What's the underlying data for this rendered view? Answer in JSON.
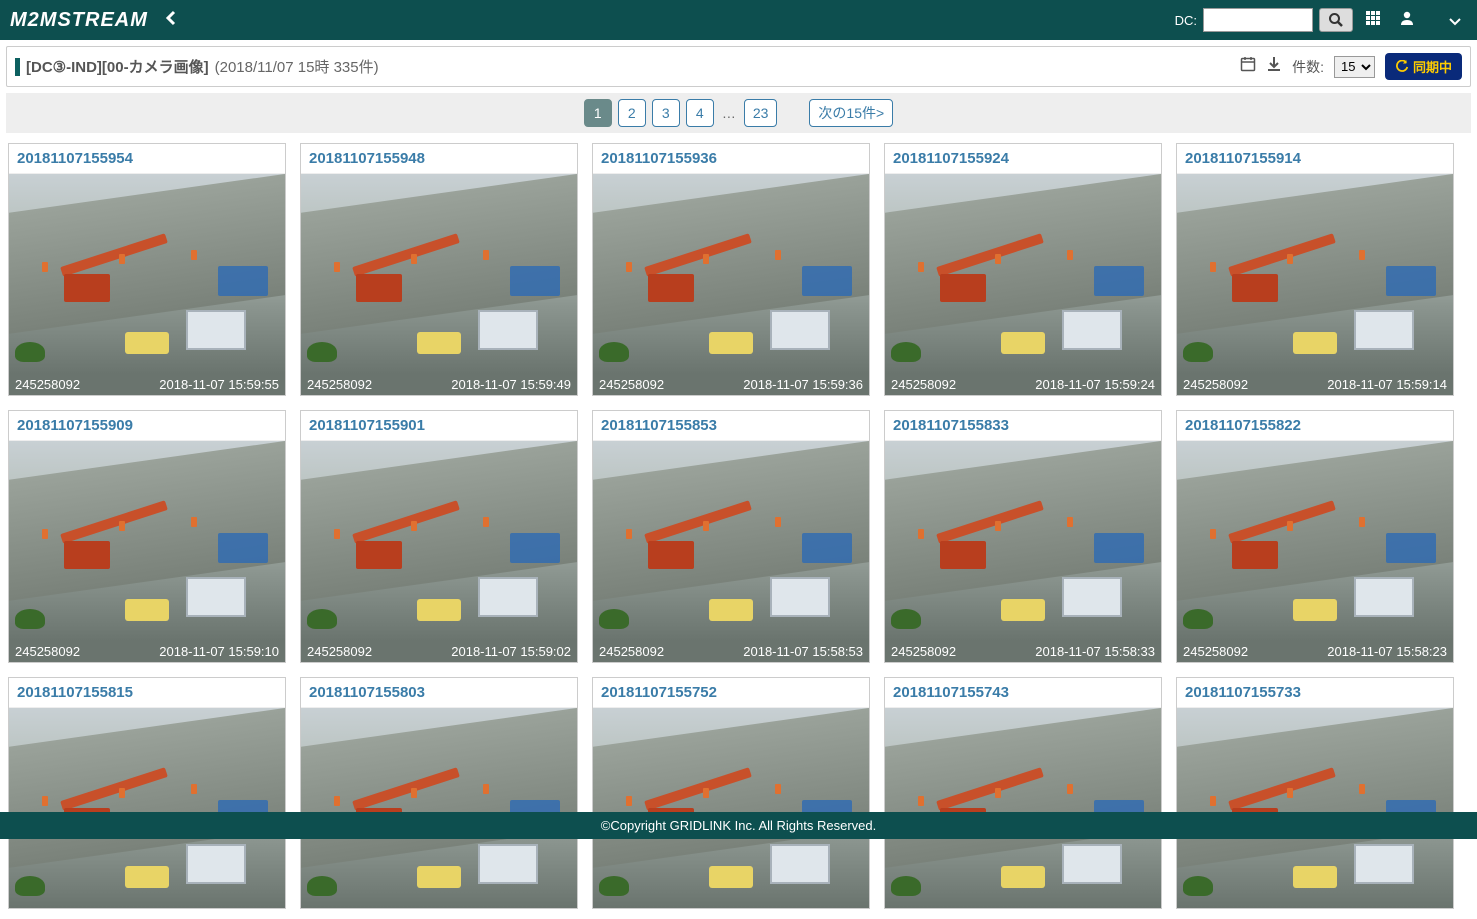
{
  "header": {
    "logo": "M2MSTREAM",
    "dc_label": "DC:",
    "dc_value": ""
  },
  "subheader": {
    "title": "[DC③-IND][00-カメラ画像]",
    "meta": "(2018/11/07 15時 335件)",
    "count_label": "件数:",
    "count_value": "15",
    "sync_label": "同期中"
  },
  "pagination": {
    "pages": [
      "1",
      "2",
      "3",
      "4"
    ],
    "active": "1",
    "ellipsis": "…",
    "last": "23",
    "next_label": "次の15件>"
  },
  "cards": [
    {
      "title": "20181107155954",
      "id": "245258092",
      "ts": "2018-11-07 15:59:55"
    },
    {
      "title": "20181107155948",
      "id": "245258092",
      "ts": "2018-11-07 15:59:49"
    },
    {
      "title": "20181107155936",
      "id": "245258092",
      "ts": "2018-11-07 15:59:36"
    },
    {
      "title": "20181107155924",
      "id": "245258092",
      "ts": "2018-11-07 15:59:24"
    },
    {
      "title": "20181107155914",
      "id": "245258092",
      "ts": "2018-11-07 15:59:14"
    },
    {
      "title": "20181107155909",
      "id": "245258092",
      "ts": "2018-11-07 15:59:10"
    },
    {
      "title": "20181107155901",
      "id": "245258092",
      "ts": "2018-11-07 15:59:02"
    },
    {
      "title": "20181107155853",
      "id": "245258092",
      "ts": "2018-11-07 15:58:53"
    },
    {
      "title": "20181107155833",
      "id": "245258092",
      "ts": "2018-11-07 15:58:33"
    },
    {
      "title": "20181107155822",
      "id": "245258092",
      "ts": "2018-11-07 15:58:23"
    },
    {
      "title": "20181107155815",
      "id": "",
      "ts": ""
    },
    {
      "title": "20181107155803",
      "id": "",
      "ts": ""
    },
    {
      "title": "20181107155752",
      "id": "",
      "ts": ""
    },
    {
      "title": "20181107155743",
      "id": "",
      "ts": ""
    },
    {
      "title": "20181107155733",
      "id": "",
      "ts": ""
    }
  ],
  "footer": "©Copyright GRIDLINK Inc. All Rights Reserved."
}
